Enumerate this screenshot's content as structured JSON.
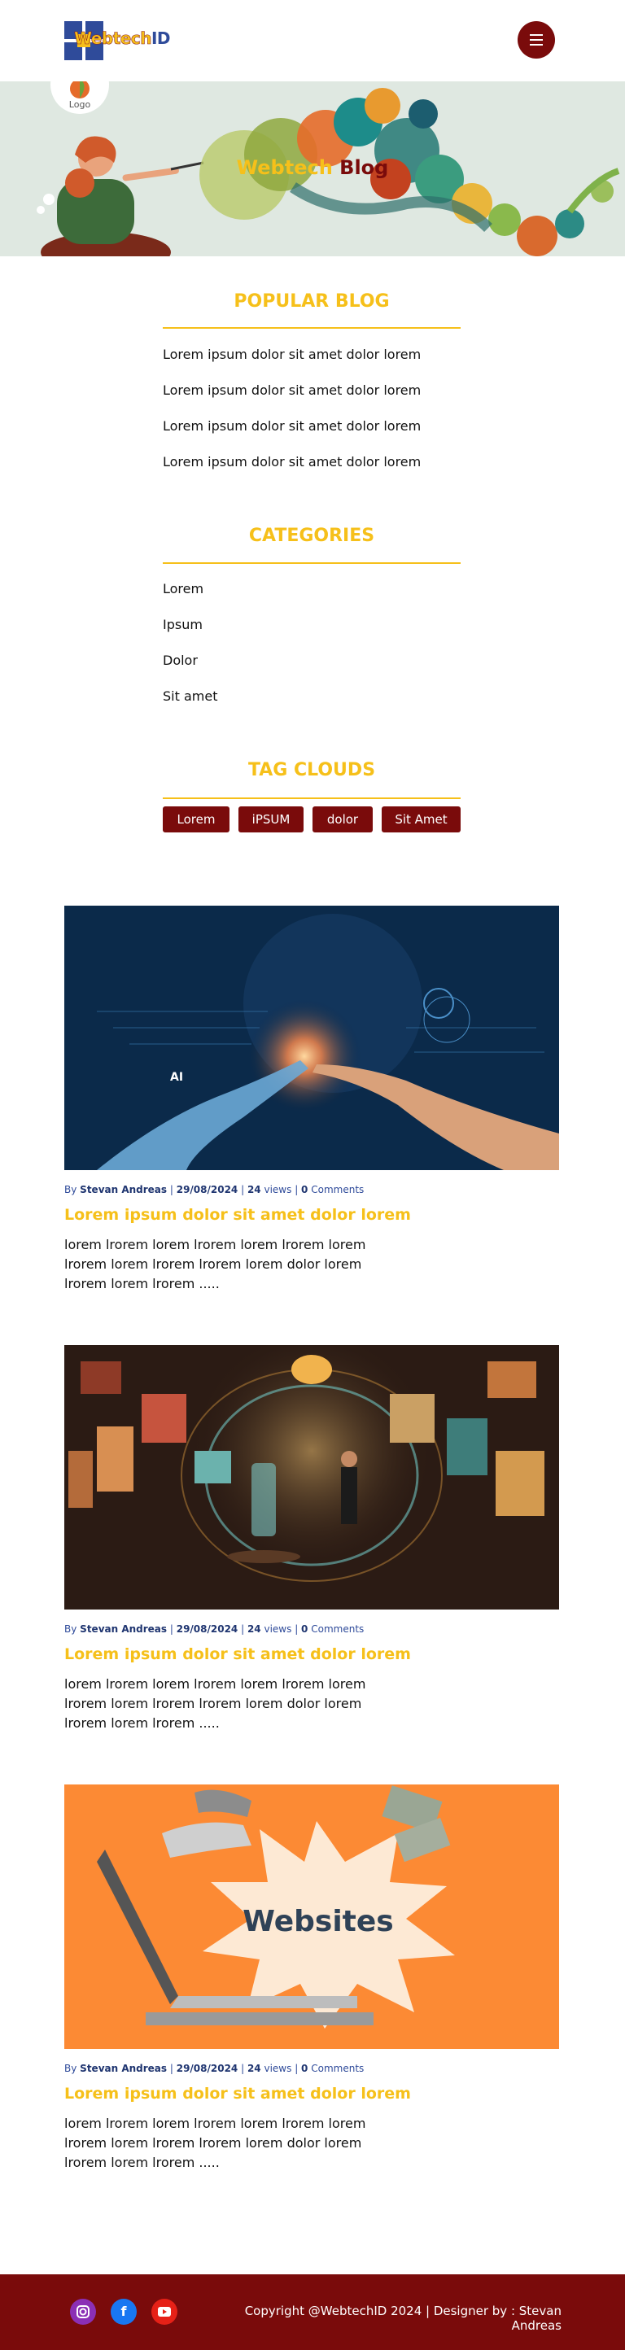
{
  "header": {
    "logo_text_main": "Webtech",
    "logo_text_id": "ID",
    "menu_icon": "hamburger-icon",
    "colors": {
      "brand_red": "#7a0b0b",
      "brand_yellow": "#f6c01a",
      "brand_blue": "#2f4b9a"
    }
  },
  "hero": {
    "title_part1": "Webtech",
    "title_part2": "Blog",
    "logo_label": "Logo"
  },
  "popular_blog": {
    "title": "POPULAR BLOG",
    "items": [
      "Lorem ipsum dolor sit amet dolor lorem",
      "Lorem ipsum dolor sit amet dolor lorem",
      "Lorem ipsum dolor sit amet dolor lorem",
      "Lorem ipsum dolor sit amet dolor lorem"
    ]
  },
  "categories": {
    "title": "CATEGORIES",
    "items": [
      "Lorem",
      "Ipsum",
      "Dolor",
      "Sit amet"
    ]
  },
  "tag_clouds": {
    "title": "TAG CLOUDS",
    "tags": [
      "Lorem",
      "iPSUM",
      "dolor",
      "Sit Amet"
    ]
  },
  "posts": [
    {
      "image_subject": "ai-hand-image",
      "by": "By",
      "author": "Stevan Andreas",
      "date": "29/08/2024",
      "views_count": "24",
      "views_label": "views",
      "comments_count": "0",
      "comments_label": "Comments",
      "title": "Lorem ipsum dolor sit amet dolor lorem",
      "excerpt": "lorem lrorem lorem lrorem lorem lrorem lorem lrorem lorem lrorem lrorem lorem dolor lorem lrorem lorem lrorem ....."
    },
    {
      "image_subject": "digital-gallery-image",
      "by": "By",
      "author": "Stevan Andreas",
      "date": "29/08/2024",
      "views_count": "24",
      "views_label": "views",
      "comments_count": "0",
      "comments_label": "Comments",
      "title": "Lorem ipsum dolor sit amet dolor lorem",
      "excerpt": "lorem lrorem lorem lrorem lorem lrorem lorem lrorem lorem lrorem lrorem lorem dolor lorem lrorem lorem lrorem ....."
    },
    {
      "image_subject": "websites-laptop-image",
      "image_text": "Websites",
      "by": "By",
      "author": "Stevan Andreas",
      "date": "29/08/2024",
      "views_count": "24",
      "views_label": "views",
      "comments_count": "0",
      "comments_label": "Comments",
      "title": "Lorem ipsum dolor sit amet dolor lorem",
      "excerpt": "lorem lrorem lorem lrorem lorem lrorem lorem lrorem lorem lrorem lrorem lorem dolor lorem lrorem lorem lrorem ....."
    }
  ],
  "footer": {
    "social_icons": [
      "instagram-icon",
      "facebook-icon",
      "youtube-icon"
    ],
    "copyright": "Copyright @WebtechID 2024 | Designer by : Stevan Andreas"
  }
}
